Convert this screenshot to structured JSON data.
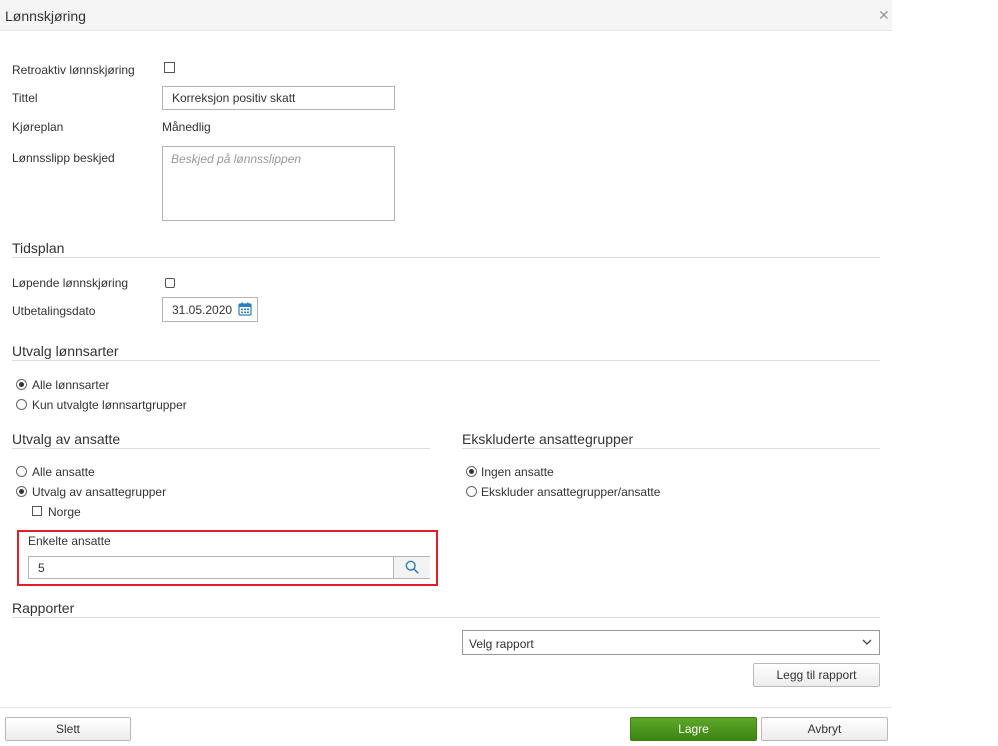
{
  "dialog": {
    "title": "Lønnskjøring",
    "close_icon": "close-icon"
  },
  "general": {
    "retroactive_label": "Retroaktiv lønnskjøring",
    "retroactive_checked": false,
    "title_label": "Tittel",
    "title_value": "Korreksjon positiv skatt",
    "schedule_label": "Kjøreplan",
    "schedule_value": "Månedlig",
    "payslip_label": "Lønnsslipp beskjed",
    "payslip_placeholder": "Beskjed på lønnsslippen",
    "payslip_value": ""
  },
  "schedule_section": {
    "title": "Tidsplan",
    "recurring_label": "Løpende lønnskjøring",
    "recurring_checked": false,
    "payout_label": "Utbetalingsdato",
    "payout_value": "31.05.2020",
    "calendar_icon": "calendar-icon"
  },
  "wage_types": {
    "title": "Utvalg lønnsarter",
    "options": [
      {
        "label": "Alle lønnsarter",
        "selected": true
      },
      {
        "label": "Kun utvalgte lønnsartgrupper",
        "selected": false
      }
    ]
  },
  "employees": {
    "title": "Utvalg av ansatte",
    "options": [
      {
        "label": "Alle ansatte",
        "selected": false
      },
      {
        "label": "Utvalg av ansattegrupper",
        "selected": true
      }
    ],
    "groups": [
      {
        "label": "Norge",
        "checked": false
      }
    ],
    "individual_label": "Enkelte ansatte",
    "individual_value": "5",
    "search_icon": "search-icon"
  },
  "excluded": {
    "title": "Ekskluderte ansattegrupper",
    "options": [
      {
        "label": "Ingen ansatte",
        "selected": true
      },
      {
        "label": "Ekskluder ansattegrupper/ansatte",
        "selected": false
      }
    ]
  },
  "reports": {
    "title": "Rapporter",
    "select_value": "Velg rapport",
    "add_label": "Legg til rapport"
  },
  "footer": {
    "delete_label": "Slett",
    "save_label": "Lagre",
    "cancel_label": "Avbryt"
  },
  "colors": {
    "primary_green": "#4a9a1f",
    "highlight_red": "#e21f26",
    "icon_blue": "#2a7fc2"
  }
}
